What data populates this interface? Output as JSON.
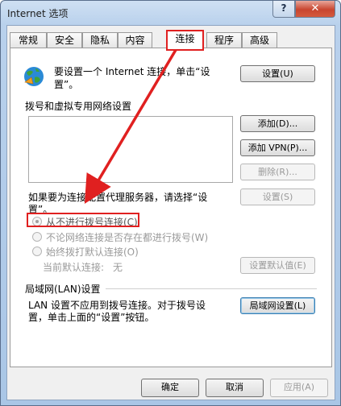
{
  "window": {
    "title": "Internet 选项",
    "help": "?",
    "close": "✕"
  },
  "tabs": [
    {
      "label": "常规"
    },
    {
      "label": "安全"
    },
    {
      "label": "隐私"
    },
    {
      "label": "内容"
    },
    {
      "label": "连接",
      "active": true
    },
    {
      "label": "程序"
    },
    {
      "label": "高级"
    }
  ],
  "connection": {
    "setup_text_line1": "要设置一个 Internet 连接，单击“设",
    "setup_text_line2": "置”。",
    "setup_button": "设置(U)",
    "dialup_group": "拨号和虚拟专用网络设置",
    "add_button": "添加(D)...",
    "add_vpn_button": "添加 VPN(P)...",
    "remove_button": "删除(R)...",
    "proxy_text_line1": "如果要为连接配置代理服务器，请选择“设",
    "proxy_text_line2": "置”。",
    "settings_button": "设置(S)",
    "radio_options": [
      {
        "label": "从不进行拨号连接(C)",
        "checked": true
      },
      {
        "label": "不论网络连接是否存在都进行拨号(W)",
        "checked": false
      },
      {
        "label": "始终拨打默认连接(O)",
        "checked": false
      }
    ],
    "current_default_label": "当前默认连接:",
    "current_default_value": "无",
    "set_default_button": "设置默认值(E)",
    "lan_group": "局域网(LAN)设置",
    "lan_text_line1": "LAN 设置不应用到拨号连接。对于拨号设",
    "lan_text_line2": "置，单击上面的“设置”按钮。",
    "lan_button": "局域网设置(L)"
  },
  "footer": {
    "ok": "确定",
    "cancel": "取消",
    "apply": "应用(A)"
  },
  "annotation_color": "#e02020"
}
